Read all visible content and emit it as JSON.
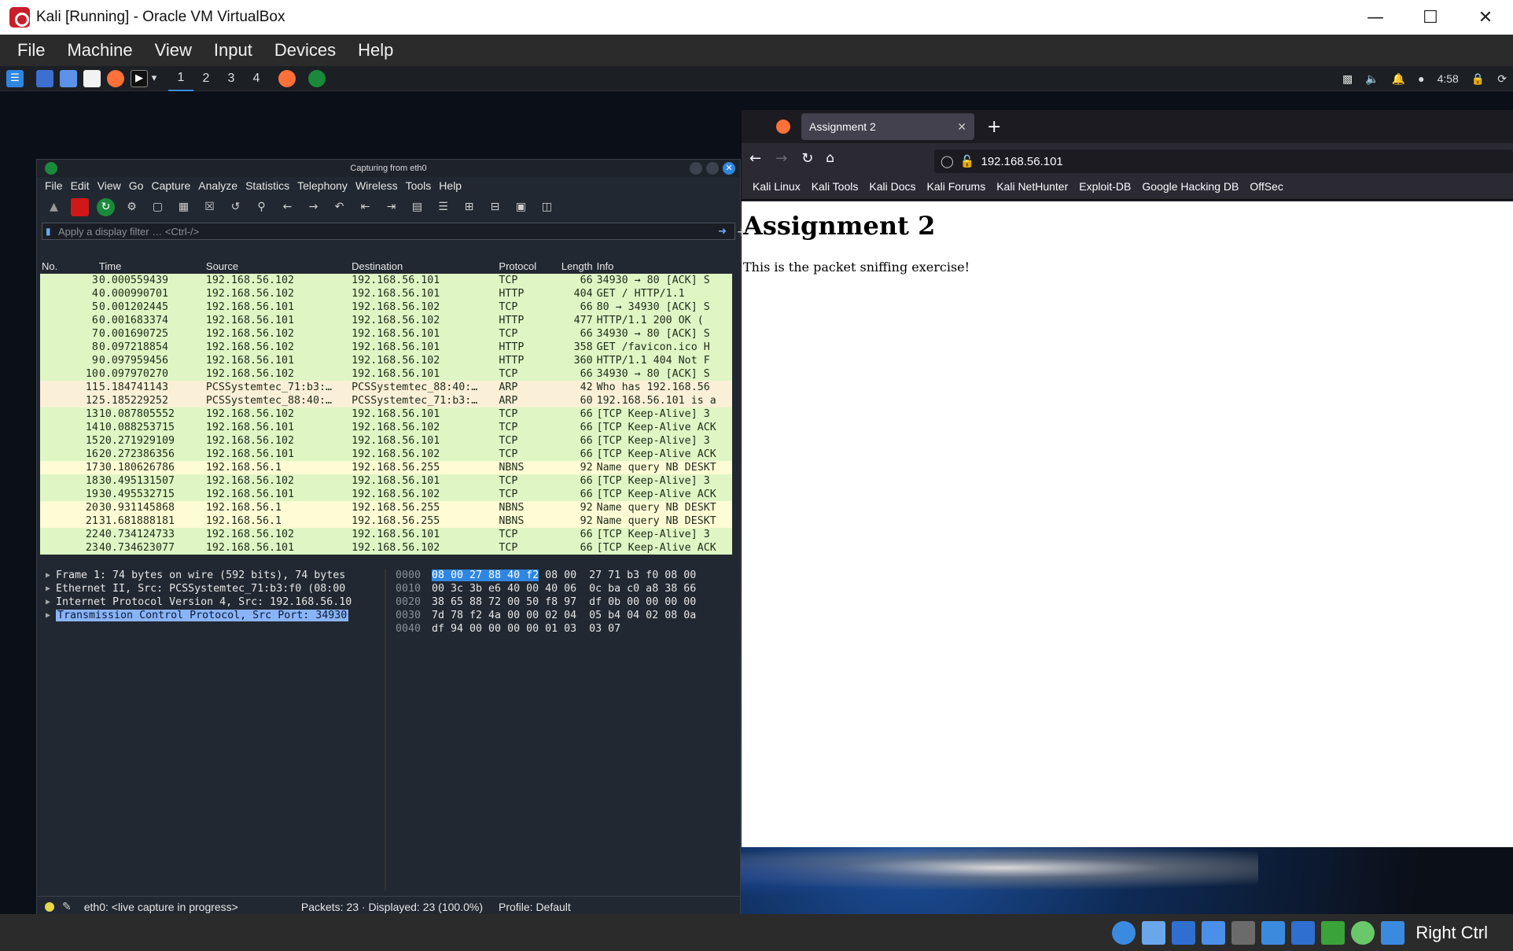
{
  "vbox": {
    "title": "Kali [Running] - Oracle VM VirtualBox",
    "menu": [
      "File",
      "Machine",
      "View",
      "Input",
      "Devices",
      "Help"
    ],
    "host_key": "Right Ctrl"
  },
  "kali_panel": {
    "workspaces": [
      "1",
      "2",
      "3",
      "4"
    ],
    "clock": "4:58"
  },
  "wireshark": {
    "title": "Capturing from eth0",
    "menu": [
      "File",
      "Edit",
      "View",
      "Go",
      "Capture",
      "Analyze",
      "Statistics",
      "Telephony",
      "Wireless",
      "Tools",
      "Help"
    ],
    "filter_placeholder": "Apply a display filter … <Ctrl-/>",
    "columns": [
      "No.",
      "Time",
      "Source",
      "Destination",
      "Protocol",
      "Length",
      "Info"
    ],
    "packets": [
      {
        "no": "3",
        "time": "0.000559439",
        "src": "192.168.56.102",
        "dst": "192.168.56.101",
        "proto": "TCP",
        "len": "66",
        "info": "34930 → 80 [ACK] S",
        "color": "#dff6c4"
      },
      {
        "no": "4",
        "time": "0.000990701",
        "src": "192.168.56.102",
        "dst": "192.168.56.101",
        "proto": "HTTP",
        "len": "404",
        "info": "GET / HTTP/1.1",
        "color": "#dff6c4"
      },
      {
        "no": "5",
        "time": "0.001202445",
        "src": "192.168.56.101",
        "dst": "192.168.56.102",
        "proto": "TCP",
        "len": "66",
        "info": "80 → 34930 [ACK] S",
        "color": "#dff6c4"
      },
      {
        "no": "6",
        "time": "0.001683374",
        "src": "192.168.56.101",
        "dst": "192.168.56.102",
        "proto": "HTTP",
        "len": "477",
        "info": "HTTP/1.1 200 OK  (",
        "color": "#dff6c4"
      },
      {
        "no": "7",
        "time": "0.001690725",
        "src": "192.168.56.102",
        "dst": "192.168.56.101",
        "proto": "TCP",
        "len": "66",
        "info": "34930 → 80 [ACK] S",
        "color": "#dff6c4"
      },
      {
        "no": "8",
        "time": "0.097218854",
        "src": "192.168.56.102",
        "dst": "192.168.56.101",
        "proto": "HTTP",
        "len": "358",
        "info": "GET /favicon.ico H",
        "color": "#dff6c4"
      },
      {
        "no": "9",
        "time": "0.097959456",
        "src": "192.168.56.101",
        "dst": "192.168.56.102",
        "proto": "HTTP",
        "len": "360",
        "info": "HTTP/1.1 404 Not F",
        "color": "#dff6c4"
      },
      {
        "no": "10",
        "time": "0.097970270",
        "src": "192.168.56.102",
        "dst": "192.168.56.101",
        "proto": "TCP",
        "len": "66",
        "info": "34930 → 80 [ACK] S",
        "color": "#dff6c4"
      },
      {
        "no": "11",
        "time": "5.184741143",
        "src": "PCSSystemtec_71:b3:…",
        "dst": "PCSSystemtec_88:40:…",
        "proto": "ARP",
        "len": "42",
        "info": "Who has 192.168.56",
        "color": "#faf0d7"
      },
      {
        "no": "12",
        "time": "5.185229252",
        "src": "PCSSystemtec_88:40:…",
        "dst": "PCSSystemtec_71:b3:…",
        "proto": "ARP",
        "len": "60",
        "info": "192.168.56.101 is a",
        "color": "#faf0d7"
      },
      {
        "no": "13",
        "time": "10.087805552",
        "src": "192.168.56.102",
        "dst": "192.168.56.101",
        "proto": "TCP",
        "len": "66",
        "info": "[TCP Keep-Alive] 3",
        "color": "#dff6c4"
      },
      {
        "no": "14",
        "time": "10.088253715",
        "src": "192.168.56.101",
        "dst": "192.168.56.102",
        "proto": "TCP",
        "len": "66",
        "info": "[TCP Keep-Alive ACK",
        "color": "#dff6c4"
      },
      {
        "no": "15",
        "time": "20.271929109",
        "src": "192.168.56.102",
        "dst": "192.168.56.101",
        "proto": "TCP",
        "len": "66",
        "info": "[TCP Keep-Alive] 3",
        "color": "#dff6c4"
      },
      {
        "no": "16",
        "time": "20.272386356",
        "src": "192.168.56.101",
        "dst": "192.168.56.102",
        "proto": "TCP",
        "len": "66",
        "info": "[TCP Keep-Alive ACK",
        "color": "#dff6c4"
      },
      {
        "no": "17",
        "time": "30.180626786",
        "src": "192.168.56.1",
        "dst": "192.168.56.255",
        "proto": "NBNS",
        "len": "92",
        "info": "Name query NB DESKT",
        "color": "#fefcd4"
      },
      {
        "no": "18",
        "time": "30.495131507",
        "src": "192.168.56.102",
        "dst": "192.168.56.101",
        "proto": "TCP",
        "len": "66",
        "info": "[TCP Keep-Alive] 3",
        "color": "#dff6c4"
      },
      {
        "no": "19",
        "time": "30.495532715",
        "src": "192.168.56.101",
        "dst": "192.168.56.102",
        "proto": "TCP",
        "len": "66",
        "info": "[TCP Keep-Alive ACK",
        "color": "#dff6c4"
      },
      {
        "no": "20",
        "time": "30.931145868",
        "src": "192.168.56.1",
        "dst": "192.168.56.255",
        "proto": "NBNS",
        "len": "92",
        "info": "Name query NB DESKT",
        "color": "#fefcd4"
      },
      {
        "no": "21",
        "time": "31.681888181",
        "src": "192.168.56.1",
        "dst": "192.168.56.255",
        "proto": "NBNS",
        "len": "92",
        "info": "Name query NB DESKT",
        "color": "#fefcd4"
      },
      {
        "no": "22",
        "time": "40.734124733",
        "src": "192.168.56.102",
        "dst": "192.168.56.101",
        "proto": "TCP",
        "len": "66",
        "info": "[TCP Keep-Alive] 3",
        "color": "#dff6c4"
      },
      {
        "no": "23",
        "time": "40.734623077",
        "src": "192.168.56.101",
        "dst": "192.168.56.102",
        "proto": "TCP",
        "len": "66",
        "info": "[TCP Keep-Alive ACK",
        "color": "#dff6c4"
      }
    ],
    "details": [
      "Frame 1: 74 bytes on wire (592 bits), 74 bytes",
      "Ethernet II, Src: PCSSystemtec_71:b3:f0 (08:00",
      "Internet Protocol Version 4, Src: 192.168.56.10",
      "Transmission Control Protocol, Src Port: 34930"
    ],
    "hex": [
      {
        "off": "0000",
        "hl": "08 00 27 88 40 f2",
        "rest": " 08 00  27 71 b3 f0 08 00"
      },
      {
        "off": "0010",
        "hl": "",
        "rest": "00 3c 3b e6 40 00 40 06  0c ba c0 a8 38 66"
      },
      {
        "off": "0020",
        "hl": "",
        "rest": "38 65 88 72 00 50 f8 97  df 0b 00 00 00 00"
      },
      {
        "off": "0030",
        "hl": "",
        "rest": "7d 78 f2 4a 00 00 02 04  05 b4 04 02 08 0a"
      },
      {
        "off": "0040",
        "hl": "",
        "rest": "df 94 00 00 00 00 01 03  03 07"
      }
    ],
    "status_iface": "eth0: <live capture in progress>",
    "status_packets": "Packets: 23 · Displayed: 23 (100.0%)",
    "status_profile": "Profile: Default"
  },
  "firefox": {
    "tab_title": "Assignment 2",
    "url": "192.168.56.101",
    "bookmarks": [
      "Kali Linux",
      "Kali Tools",
      "Kali Docs",
      "Kali Forums",
      "Kali NetHunter",
      "Exploit-DB",
      "Google Hacking DB",
      "OffSec"
    ],
    "page_heading": "Assignment 2",
    "page_text": "This is the packet sniffing exercise!"
  }
}
